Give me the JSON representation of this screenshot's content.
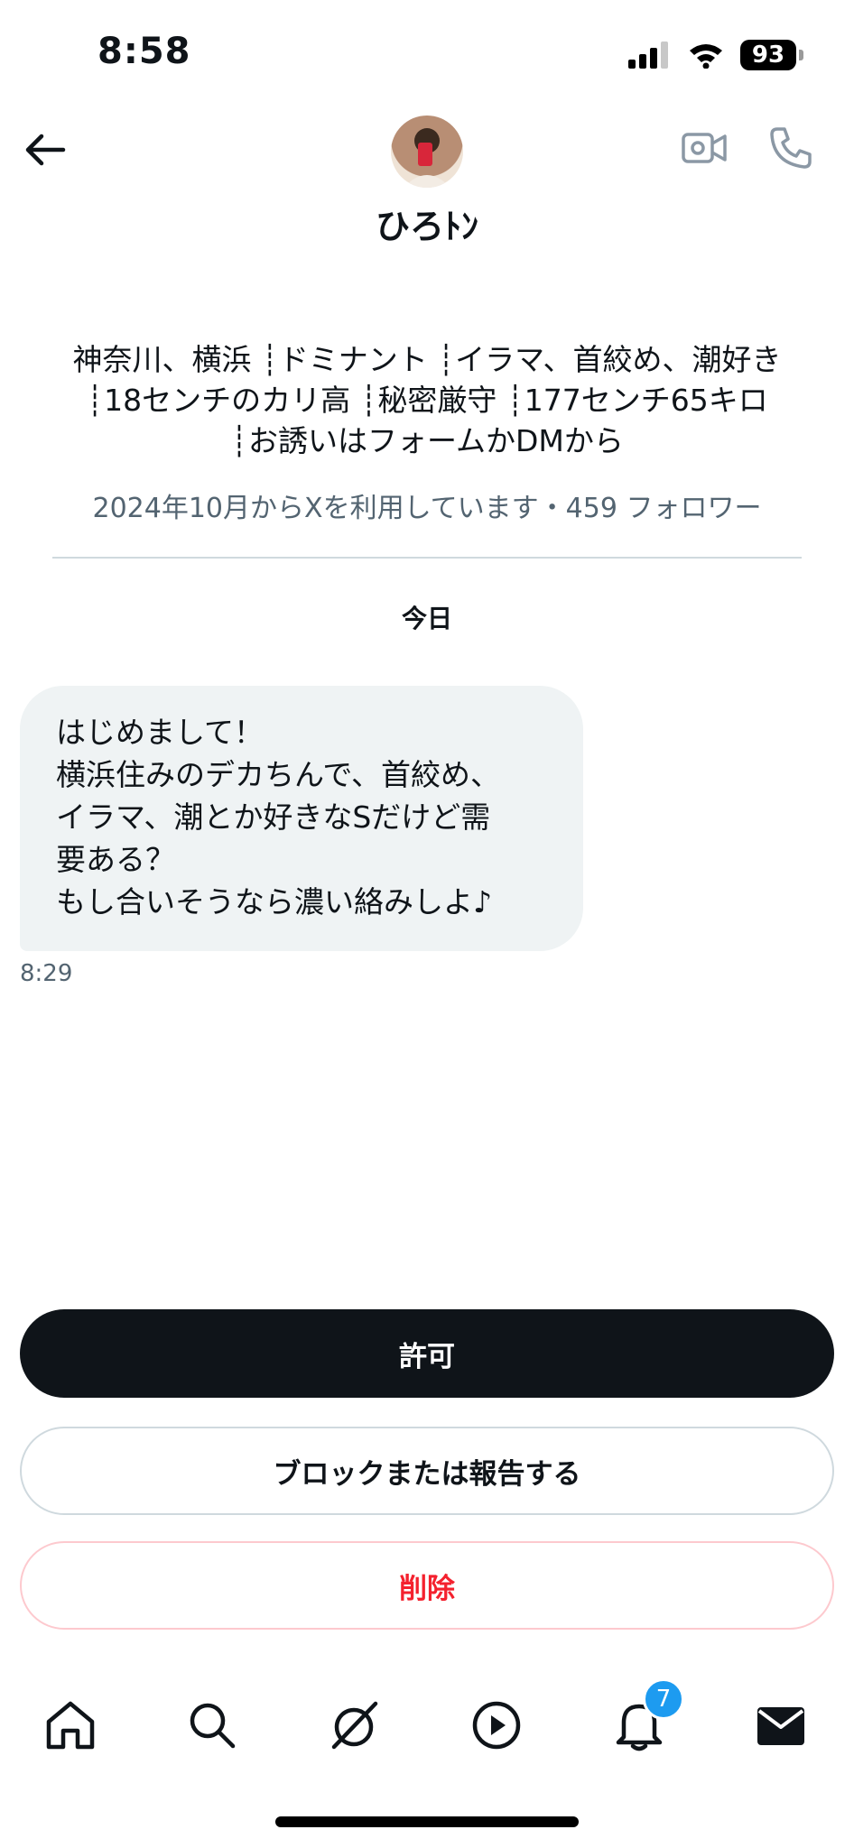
{
  "status_bar": {
    "time": "8:58",
    "battery": "93"
  },
  "header": {
    "display_name": "ひろﾄﾝ"
  },
  "profile": {
    "bio_lines": [
      "神奈川、横浜 ┊ドミナント ┊イラマ、首絞め、潮好き",
      "┊18センチのカリ高 ┊秘密厳守 ┊177センチ65キロ",
      "┊お誘いはフォームかDMから"
    ],
    "joined": "2024年10月からXを利用しています・459 フォロワー"
  },
  "conversation": {
    "date_separator": "今日",
    "messages": [
      {
        "text": "はじめまして！\n横浜住みのデカちんで、首絞め、\nイラマ、潮とか好きなSだけど需\n要ある？\nもし合いそうなら濃い絡みしよ♪",
        "time": "8:29"
      }
    ]
  },
  "actions": {
    "allow": "許可",
    "block_report": "ブロックまたは報告する",
    "delete": "削除"
  },
  "tab_bar": {
    "items": [
      "home-icon",
      "search-icon",
      "grok-icon",
      "video-icon",
      "notifications-icon",
      "messages-icon"
    ],
    "notification_badge": "7"
  },
  "colors": {
    "primary_button": "#0f1419",
    "delete_red": "#f4212e",
    "badge_blue": "#1d9bf0",
    "bubble_bg": "#eff3f4"
  }
}
